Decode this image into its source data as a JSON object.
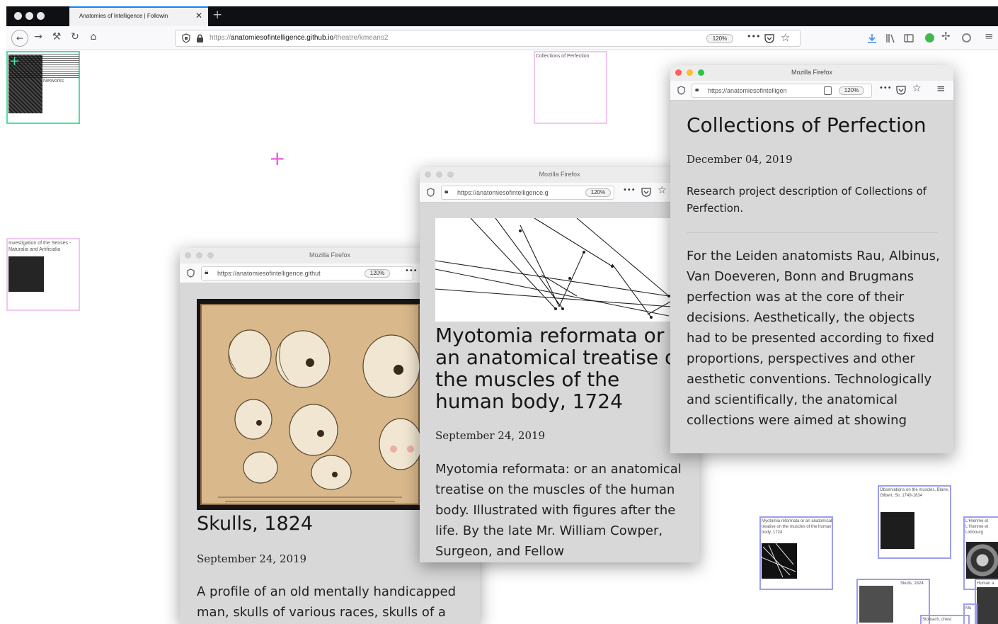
{
  "browser": {
    "tab_title": "Anatomies of Intelligence | Followin",
    "tab_close": "✕",
    "new_tab": "+",
    "url_prefix": "https://",
    "url_domain": "anatomiesofintelligence.github.io",
    "url_path": "/theatre/kmeans2",
    "zoom": "120%",
    "more": "•••"
  },
  "canvas": {
    "frame_networks_label": "Networks",
    "frame_perfection_label": "Collections of Perfection",
    "frame_senses_label": "Investigation of the Senses - Naturalia and Artificialia",
    "frame_myotomia_label": "Myotomia reformata or an anatomical treatise on the muscles of the human body, 1724",
    "frame_observations_label": "Observations on the muscles, Blane, Gilbert, Sir, 1749-1834",
    "frame_skulls_label": "Skulls, 1824",
    "frame_homme_label": "L'Homme et L'Homme et Limbourg",
    "frame_human_label": "Human a",
    "frame_stomach_label": "Stomach, chest",
    "frame_small_label": "Mu"
  },
  "popup_perfection": {
    "window_title": "Mozilla Firefox",
    "url": "https://anatomiesofintelligen",
    "zoom": "120%",
    "title": "Collections of Perfection",
    "date": "December 04, 2019",
    "description": "Research project description of Collections of Perfection.",
    "body": "For the Leiden anatomists Rau, Albinus, Van Doeveren, Bonn and Brugmans perfection was at the core of their decisions. Aesthetically, the objects had to be presented according to fixed proportions, perspectives and other aesthetic conventions. Technologically and scientifically, the anatomical collections were aimed at showing"
  },
  "popup_myotomia": {
    "window_title": "Mozilla Firefox",
    "url": "https://anatomiesofintelligence.g",
    "zoom": "120%",
    "title": "Myotomia reformata or an anatomical treatise on the muscles of the human body, 1724",
    "date": "September 24, 2019",
    "body": "Myotomia reformata: or an anatomical treatise on the muscles of the human body. Illustrated with figures after the life. By the late Mr. William Cowper, Surgeon, and Fellow"
  },
  "popup_skulls": {
    "window_title": "Mozilla Firefox",
    "url": "https://anatomiesofintelligence.githut",
    "zoom": "120%",
    "title": "Skulls, 1824",
    "date": "September 24, 2019",
    "body": "A profile of an old mentally handicapped man, skulls of various races, skulls of a"
  },
  "colors": {
    "frame_pink": "#f1c7ef",
    "frame_blue": "#9c9ef0",
    "frame_green": "#47e3a0",
    "crosshair_pink": "#e55de0"
  }
}
